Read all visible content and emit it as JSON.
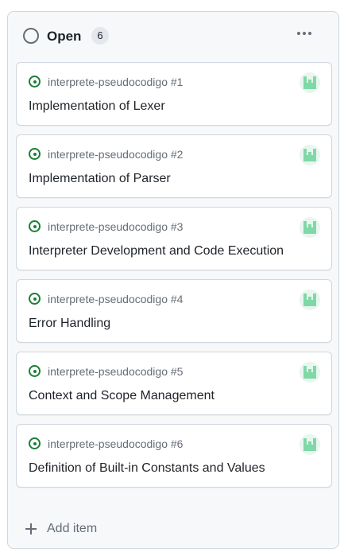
{
  "column": {
    "title": "Open",
    "count": "6",
    "more_icon": "kebab-horizontal-icon",
    "status_icon": "circle-outline-icon"
  },
  "cards": [
    {
      "repo": "interprete-pseudocodigo",
      "number": "#1",
      "title": "Implementation of Lexer"
    },
    {
      "repo": "interprete-pseudocodigo",
      "number": "#2",
      "title": "Implementation of Parser"
    },
    {
      "repo": "interprete-pseudocodigo",
      "number": "#3",
      "title": "Interpreter Development and Code Execution"
    },
    {
      "repo": "interprete-pseudocodigo",
      "number": "#4",
      "title": "Error Handling"
    },
    {
      "repo": "interprete-pseudocodigo",
      "number": "#5",
      "title": "Context and Scope Management"
    },
    {
      "repo": "interprete-pseudocodigo",
      "number": "#6",
      "title": "Definition of Built-in Constants and Values"
    }
  ],
  "add_item": {
    "label": "Add item",
    "icon": "plus-icon"
  },
  "colors": {
    "issue_open": "#1a7f37",
    "muted_text": "#656d76",
    "text": "#1f2328",
    "avatar": "#7fd8a6"
  }
}
